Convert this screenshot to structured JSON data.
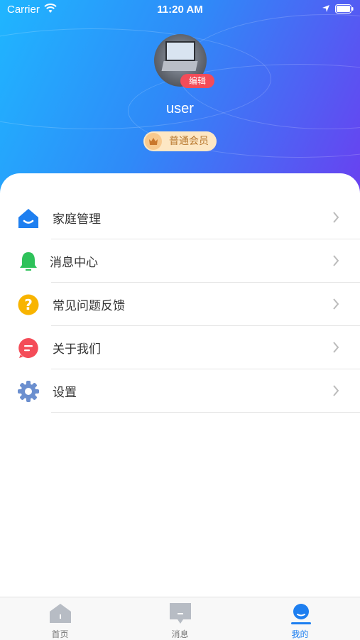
{
  "status_bar": {
    "carrier": "Carrier",
    "time": "11:20 AM"
  },
  "profile": {
    "edit_label": "编辑",
    "username": "user",
    "member_level": "普通会员"
  },
  "menu": [
    {
      "label": "家庭管理",
      "icon": "home-icon",
      "color": "#1e7ff0"
    },
    {
      "label": "消息中心",
      "icon": "bell-icon",
      "color": "#2ec25a"
    },
    {
      "label": "常见问题反馈",
      "icon": "question-icon",
      "color": "#f8b400"
    },
    {
      "label": "关于我们",
      "icon": "chat-icon",
      "color": "#f44c58"
    },
    {
      "label": "设置",
      "icon": "gear-icon",
      "color": "#6b8fcf"
    }
  ],
  "tabbar": {
    "tabs": [
      {
        "label": "首页",
        "icon": "home-tab-icon"
      },
      {
        "label": "消息",
        "icon": "message-tab-icon"
      },
      {
        "label": "我的",
        "icon": "profile-tab-icon"
      }
    ],
    "active_index": 2
  },
  "colors": {
    "gradient_start": "#1fb6ff",
    "gradient_end": "#6a3ff0",
    "accent": "#1e7ff0",
    "edit_badge": "#f44c58",
    "member_badge_bg": "#fde7c4",
    "member_badge_text": "#b8782f"
  }
}
